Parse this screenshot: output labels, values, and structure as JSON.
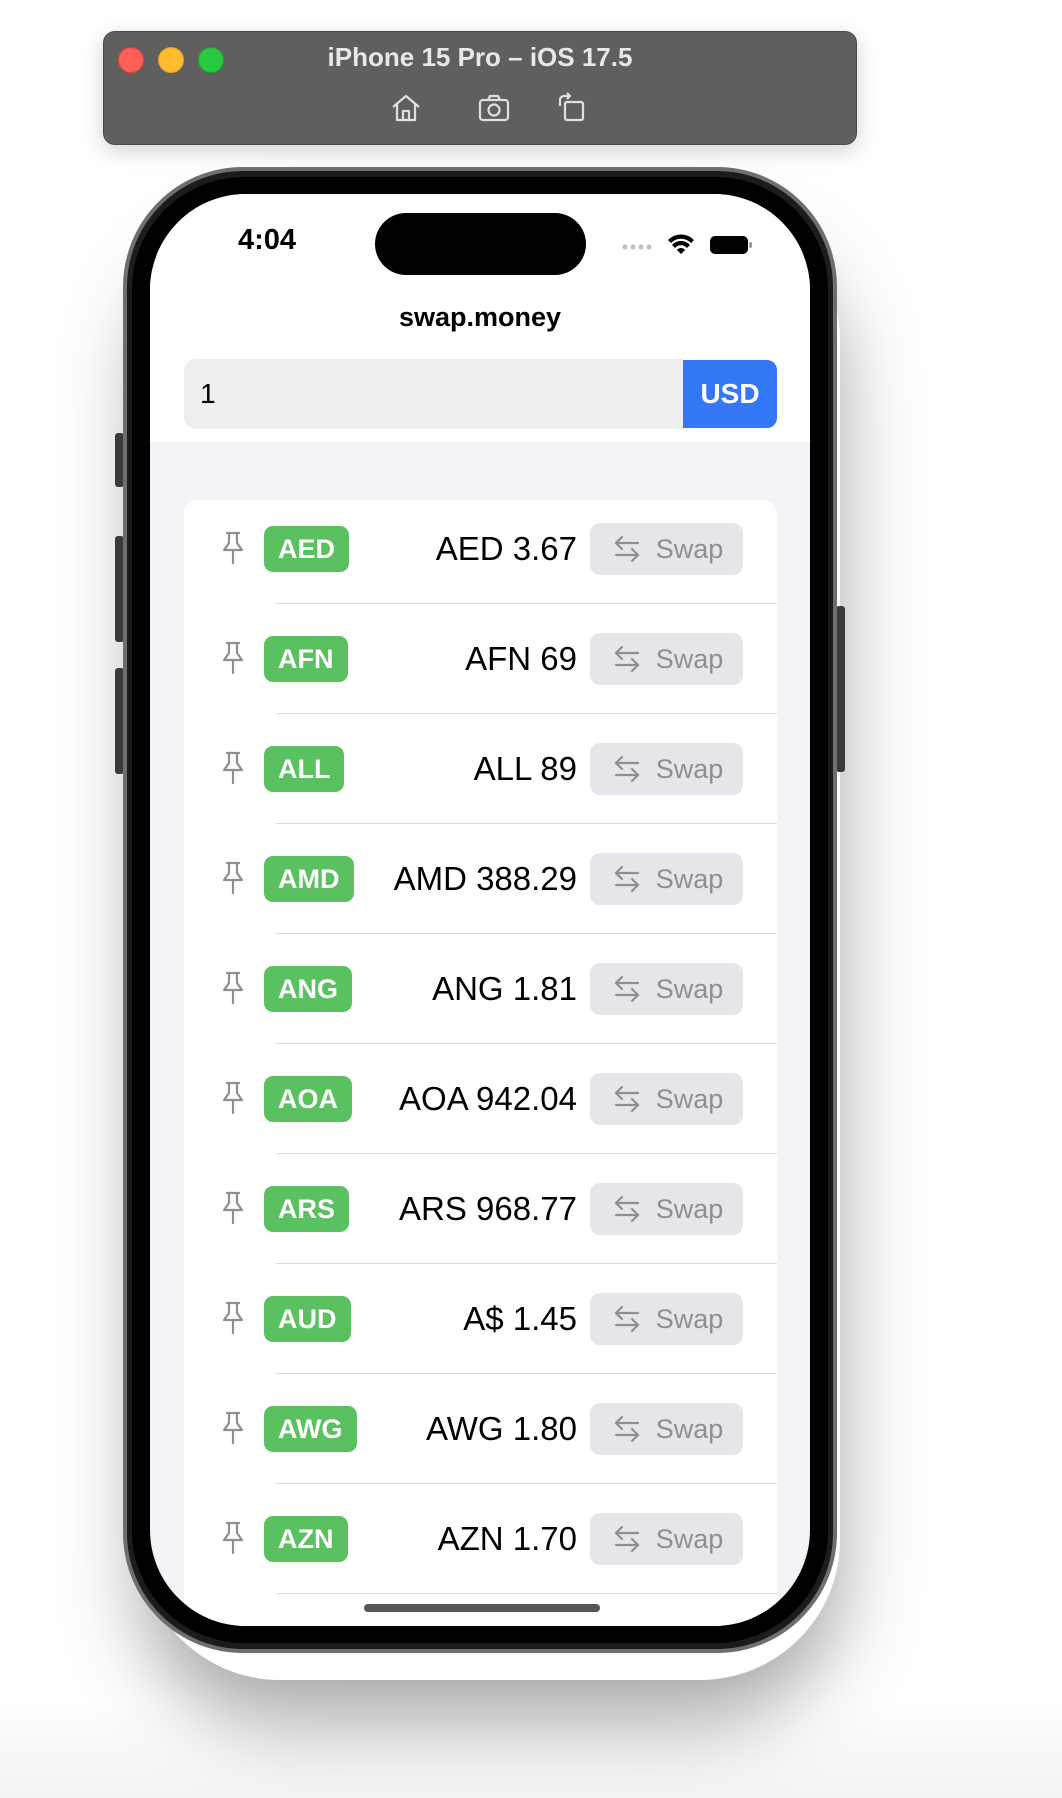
{
  "window": {
    "title": "iPhone 15 Pro – iOS 17.5",
    "toolbar": [
      "home-icon",
      "screenshot-icon",
      "rotate-icon"
    ]
  },
  "status_bar": {
    "time": "4:04",
    "icons": [
      "cellular-icon",
      "wifi-icon",
      "battery-icon"
    ]
  },
  "app": {
    "title": "swap.money",
    "amount_value": "1",
    "base_currency": "USD"
  },
  "colors": {
    "accent": "#3478f6",
    "badge_green": "#5ac060",
    "swap_bg": "#e6e6ea",
    "list_bg": "#f2f2f7"
  },
  "rows": [
    {
      "code": "AED",
      "amount": "AED 3.67",
      "swap_label": "Swap"
    },
    {
      "code": "AFN",
      "amount": "AFN 69",
      "swap_label": "Swap"
    },
    {
      "code": "ALL",
      "amount": "ALL 89",
      "swap_label": "Swap"
    },
    {
      "code": "AMD",
      "amount": "AMD 388.29",
      "swap_label": "Swap"
    },
    {
      "code": "ANG",
      "amount": "ANG 1.81",
      "swap_label": "Swap"
    },
    {
      "code": "AOA",
      "amount": "AOA 942.04",
      "swap_label": "Swap"
    },
    {
      "code": "ARS",
      "amount": "ARS 968.77",
      "swap_label": "Swap"
    },
    {
      "code": "AUD",
      "amount": "A$ 1.45",
      "swap_label": "Swap"
    },
    {
      "code": "AWG",
      "amount": "AWG 1.80",
      "swap_label": "Swap"
    },
    {
      "code": "AZN",
      "amount": "AZN 1.70",
      "swap_label": "Swap"
    }
  ]
}
